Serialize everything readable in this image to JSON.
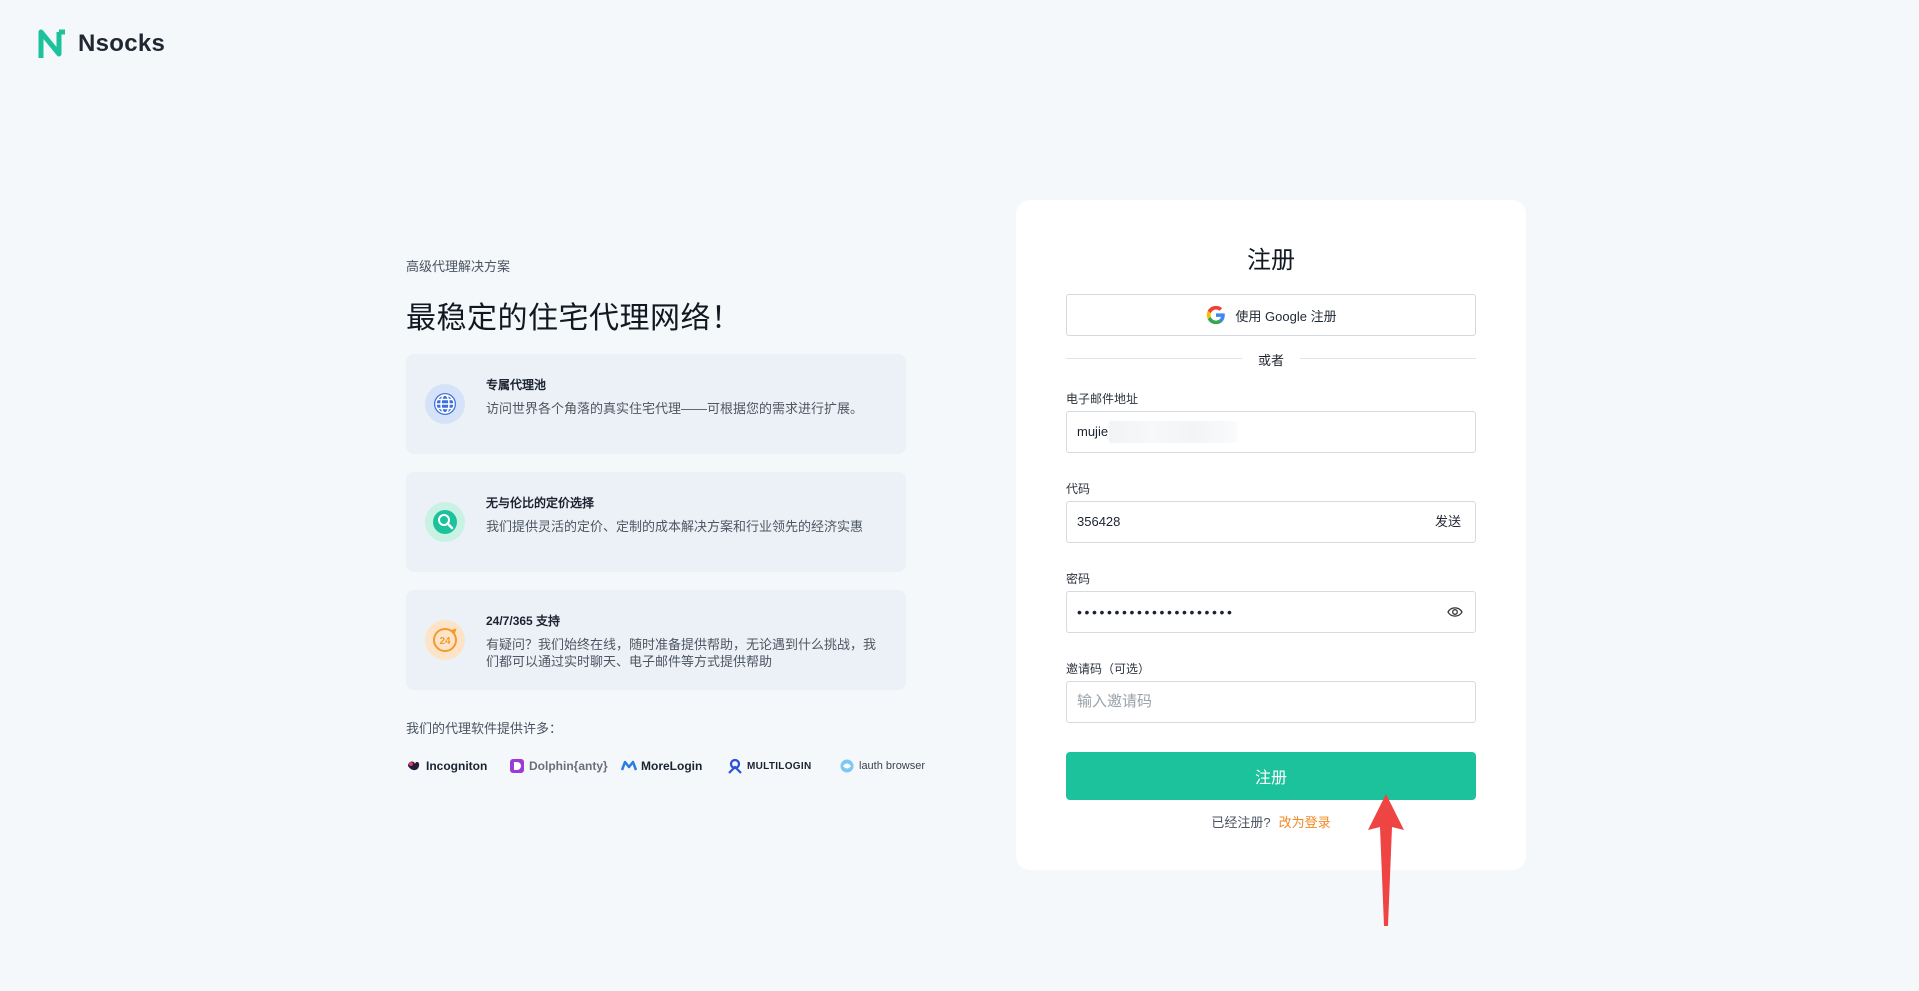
{
  "brand": {
    "name": "Nsocks",
    "accent": "#1bc29b"
  },
  "hero": {
    "tagline": "高级代理解决方案",
    "headline": "最稳定的住宅代理网络！"
  },
  "features": [
    {
      "icon": "globe-icon",
      "title": "专属代理池",
      "desc": "访问世界各个角落的真实住宅代理——可根据您的需求进行扩展。"
    },
    {
      "icon": "magnifier-icon",
      "title": "无与伦比的定价选择",
      "desc": "我们提供灵活的定价、定制的成本解决方案和行业领先的经济实惠"
    },
    {
      "icon": "support-24-icon",
      "title": "24/7/365 支持",
      "desc": "有疑问？我们始终在线，随时准备提供帮助，无论遇到什么挑战，我们都可以通过实时聊天、电子邮件等方式提供帮助"
    }
  ],
  "partners": {
    "label": "我们的代理软件提供许多：",
    "items": [
      "Incogniton",
      "Dolphin{anty}",
      "MoreLogin",
      "MULTILOGIN",
      "lauth browser"
    ]
  },
  "form": {
    "title": "注册",
    "google_label": "使用 Google 注册",
    "or_label": "或者",
    "email_label": "电子邮件地址",
    "email_value": "mujie",
    "code_label": "代码",
    "code_value": "356428",
    "send_label": "发送",
    "password_label": "密码",
    "password_dots": "•••••••••••••••••••••",
    "invite_label": "邀请码（可选）",
    "invite_placeholder": "输入邀请码",
    "submit_label": "注册",
    "login_prompt": "已经注册?",
    "login_link": "改为登录"
  },
  "annotation": {
    "arrow_color": "#ef4444"
  }
}
